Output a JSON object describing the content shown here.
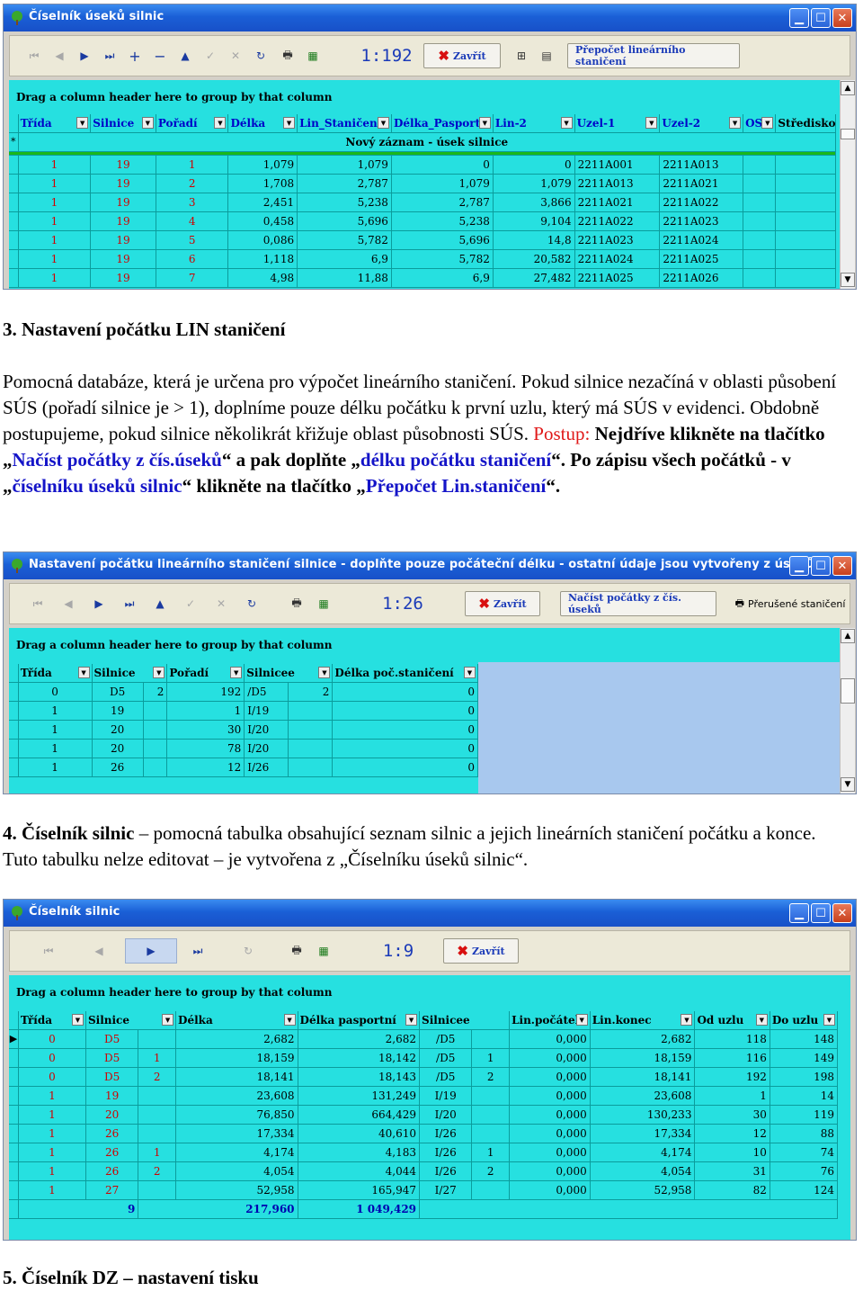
{
  "win1": {
    "title": "Číselník úseků silnic",
    "toolbar": {
      "counter": "1:192",
      "close_label": "Zavřít",
      "recalc_label": "Přepočet lineárního staničení"
    },
    "group_hint": "Drag a column header here to group by that column",
    "new_row_label": "Nový záznam - úsek silnice",
    "columns": [
      "Třída",
      "Silnice",
      "Pořadí",
      "Délka",
      "Lin_Staničení",
      "Délka_Pasport",
      "Lin-2",
      "Uzel-1",
      "Uzel-2",
      "OS",
      "Středisko"
    ],
    "rows": [
      [
        "1",
        "19",
        "1",
        "1,079",
        "1,079",
        "0",
        "0",
        "2211A001",
        "2211A013"
      ],
      [
        "1",
        "19",
        "2",
        "1,708",
        "2,787",
        "1,079",
        "1,079",
        "2211A013",
        "2211A021"
      ],
      [
        "1",
        "19",
        "3",
        "2,451",
        "5,238",
        "2,787",
        "3,866",
        "2211A021",
        "2211A022"
      ],
      [
        "1",
        "19",
        "4",
        "0,458",
        "5,696",
        "5,238",
        "9,104",
        "2211A022",
        "2211A023"
      ],
      [
        "1",
        "19",
        "5",
        "0,086",
        "5,782",
        "5,696",
        "14,8",
        "2211A023",
        "2211A024"
      ],
      [
        "1",
        "19",
        "6",
        "1,118",
        "6,9",
        "5,782",
        "20,582",
        "2211A024",
        "2211A025"
      ],
      [
        "1",
        "19",
        "7",
        "4,98",
        "11,88",
        "6,9",
        "27,482",
        "2211A025",
        "2211A026"
      ]
    ]
  },
  "section3": {
    "heading": "3. Nastavení počátku LIN staničení",
    "p1": "Pomocná databáze, která je určena pro výpočet lineárního staničení. Pokud silnice nezačíná v oblasti působení SÚS (pořadí silnice je > 1), doplníme pouze délku počátku k první uzlu, který má SÚS v evidenci. Obdobně postupujeme, pokud silnice několikrát křižuje oblast působnosti SÚS.",
    "postup": "Postup:",
    "s1": "Nejdříve klikněte na tlačítko „",
    "s1b": "Načíst počátky z čís.úseků",
    "s2": "“ a pak doplňte „",
    "s2b": "délku počátku staničení",
    "s3": "“. Po zápisu všech počátků - v „",
    "s3b": "číselníku úseků silnic",
    "s4": "“ klikněte na tlačítko „",
    "s4b": "Přepočet Lin.staničení",
    "s5": "“."
  },
  "win2": {
    "title": "Nastavení počátku lineárního staničení silnice - doplňte pouze počáteční délku - ostatní údaje jsou vytvořeny z úseků",
    "toolbar": {
      "counter": "1:26",
      "close_label": "Zavřít",
      "load_label": "Načíst počátky z čís. úseků",
      "interrupted_label": "Přerušené staničení"
    },
    "group_hint": "Drag a column header here to group by that column",
    "columns": [
      "Třída",
      "Silnice",
      "Pořadí",
      "Silnicee",
      "Délka poč.staničení"
    ],
    "rows": [
      [
        "0",
        "D5",
        "2",
        "192",
        "/D5",
        "2",
        "0"
      ],
      [
        "1",
        "19",
        "",
        "1",
        "I/19",
        "",
        "0"
      ],
      [
        "1",
        "20",
        "",
        "30",
        "I/20",
        "",
        "0"
      ],
      [
        "1",
        "20",
        "",
        "78",
        "I/20",
        "",
        "0"
      ],
      [
        "1",
        "26",
        "",
        "12",
        "I/26",
        "",
        "0"
      ]
    ]
  },
  "section4": {
    "heading": "4. Číselník silnic",
    "rest": " – pomocná tabulka obsahující seznam silnic a jejich lineárních staničení počátku a konce. Tuto tabulku nelze editovat – je vytvořena z „Číselníku úseků silnic“."
  },
  "win3": {
    "title": "Číselník silnic",
    "toolbar": {
      "counter": "1:9",
      "close_label": "Zavřít"
    },
    "group_hint": "Drag a column header here to group by that column",
    "columns": [
      "Třída",
      "Silnice",
      "Délka",
      "Délka pasportní",
      "Silnicee",
      "Lin.počátek",
      "Lin.konec",
      "Od uzlu",
      "Do uzlu"
    ],
    "rows": [
      [
        "0",
        "D5",
        "",
        "2,682",
        "2,682",
        "/D5",
        "",
        "0,000",
        "2,682",
        "118",
        "148"
      ],
      [
        "0",
        "D5",
        "1",
        "18,159",
        "18,142",
        "/D5",
        "1",
        "0,000",
        "18,159",
        "116",
        "149"
      ],
      [
        "0",
        "D5",
        "2",
        "18,141",
        "18,143",
        "/D5",
        "2",
        "0,000",
        "18,141",
        "192",
        "198"
      ],
      [
        "1",
        "19",
        "",
        "23,608",
        "131,249",
        "I/19",
        "",
        "0,000",
        "23,608",
        "1",
        "14"
      ],
      [
        "1",
        "20",
        "",
        "76,850",
        "664,429",
        "I/20",
        "",
        "0,000",
        "130,233",
        "30",
        "119"
      ],
      [
        "1",
        "26",
        "",
        "17,334",
        "40,610",
        "I/26",
        "",
        "0,000",
        "17,334",
        "12",
        "88"
      ],
      [
        "1",
        "26",
        "1",
        "4,174",
        "4,183",
        "I/26",
        "1",
        "0,000",
        "4,174",
        "10",
        "74"
      ],
      [
        "1",
        "26",
        "2",
        "4,054",
        "4,044",
        "I/26",
        "2",
        "0,000",
        "4,054",
        "31",
        "76"
      ],
      [
        "1",
        "27",
        "",
        "52,958",
        "165,947",
        "I/27",
        "",
        "0,000",
        "52,958",
        "82",
        "124"
      ]
    ],
    "summary": {
      "count": "9",
      "delka": "217,960",
      "pasport": "1 049,429"
    }
  },
  "section5": {
    "heading": "5. Číselník DZ – nastavení tisku"
  }
}
